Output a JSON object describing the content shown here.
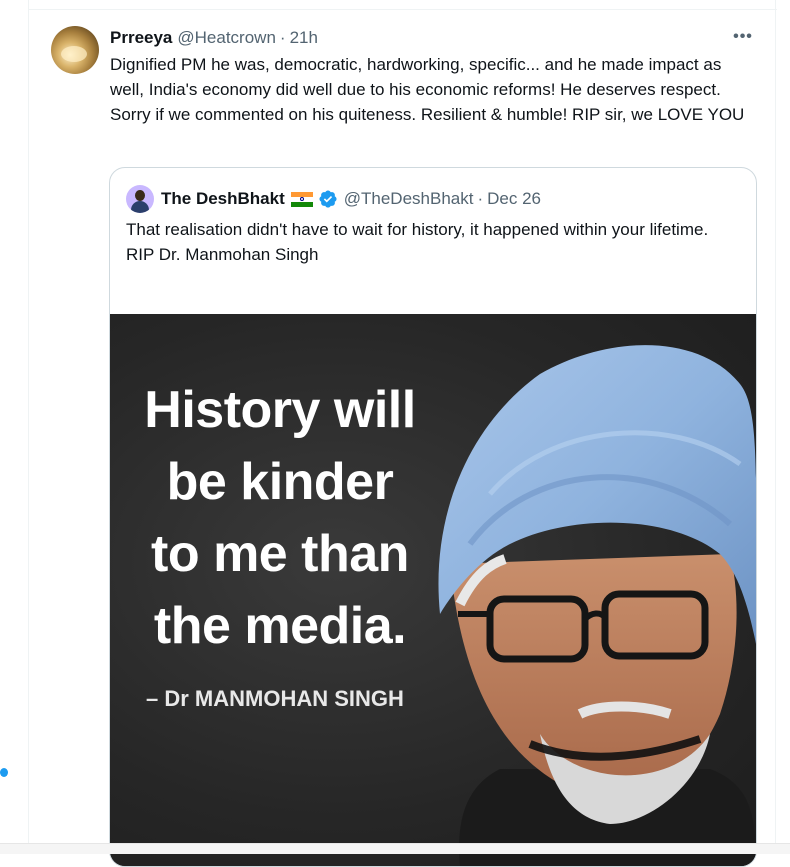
{
  "tweet": {
    "display_name": "Prreeya",
    "handle": "@Heatcrown",
    "separator": "·",
    "time": "21h",
    "more_label": "•••",
    "text": "Dignified PM he was, democratic, hardworking, specific... and he made impact as well, India's economy did well due to his economic reforms! He deserves respect. Sorry if we commented on his quiteness. Resilient & humble! RIP sir, we LOVE YOU"
  },
  "quoted_tweet": {
    "display_name": "The DeshBhakt",
    "flag_icon": "india-flag-icon",
    "verified_icon": "verified-badge-icon",
    "handle": "@TheDeshBhakt",
    "separator": "·",
    "date": "Dec 26",
    "text_lines": [
      "That realisation didn't have to wait for history, it happened within your lifetime.",
      "RIP Dr. Manmohan Singh"
    ],
    "image": {
      "quote_lines": [
        "History will",
        "be kinder",
        "to me than",
        "the media."
      ],
      "attribution": "– Dr MANMOHAN SINGH"
    }
  },
  "colors": {
    "text_primary": "#0f1419",
    "text_secondary": "#536471",
    "border": "#cfd9de",
    "accent": "#1d9bf0",
    "turban": "#8fb3de"
  }
}
